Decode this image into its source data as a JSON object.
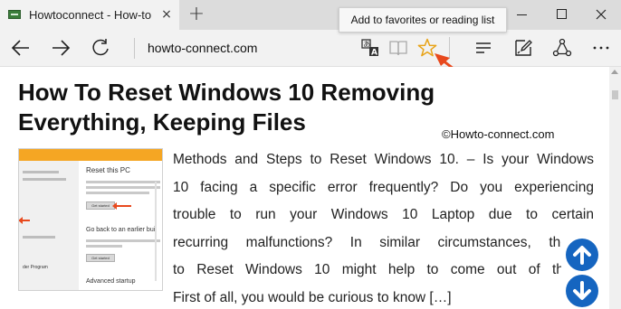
{
  "tab": {
    "title": "Howtoconnect - How-to",
    "close_glyph": "×",
    "favicon": "site-favicon-icon"
  },
  "new_tab_glyph": "+",
  "tooltip": "Add to favorites or reading list",
  "address_bar": {
    "url": "howto-connect.com"
  },
  "toolbar_icons": [
    "back-icon",
    "forward-icon",
    "refresh-icon",
    "translate-icon",
    "reading-view-icon",
    "favorite-star-icon",
    "hub-icon",
    "web-note-icon",
    "share-icon",
    "more-icon"
  ],
  "colors": {
    "accent_star": "#e8a317",
    "annotation_arrow": "#e8491d",
    "float_button": "#1565c0"
  },
  "article": {
    "headline_line1": "How To Reset Windows 10 Removing",
    "headline_line2": "Everything, Keeping Files",
    "watermark": "©Howto-connect.com",
    "paragraph_lines": [
      "Methods and Steps to Reset Windows 10. – Is your Windows",
      "10 facing a specific error frequently? Do you experiencing",
      "trouble to run your Windows 10 Laptop due to certain",
      "recurring malfunctions? In similar circumstances, the o",
      "to Reset Windows 10 might help to come out of the is",
      "First of all, you would be curious to know […]"
    ]
  },
  "thumbnail": {
    "heading": "Reset this PC",
    "button1": "Get started",
    "subheading": "Go back to an earlier bui",
    "button2": "Get started",
    "footer": "Advanced startup",
    "side_label": "der Program"
  },
  "float_buttons": {
    "up": "arrow-up-circle-icon",
    "down": "arrow-down-circle-icon"
  }
}
